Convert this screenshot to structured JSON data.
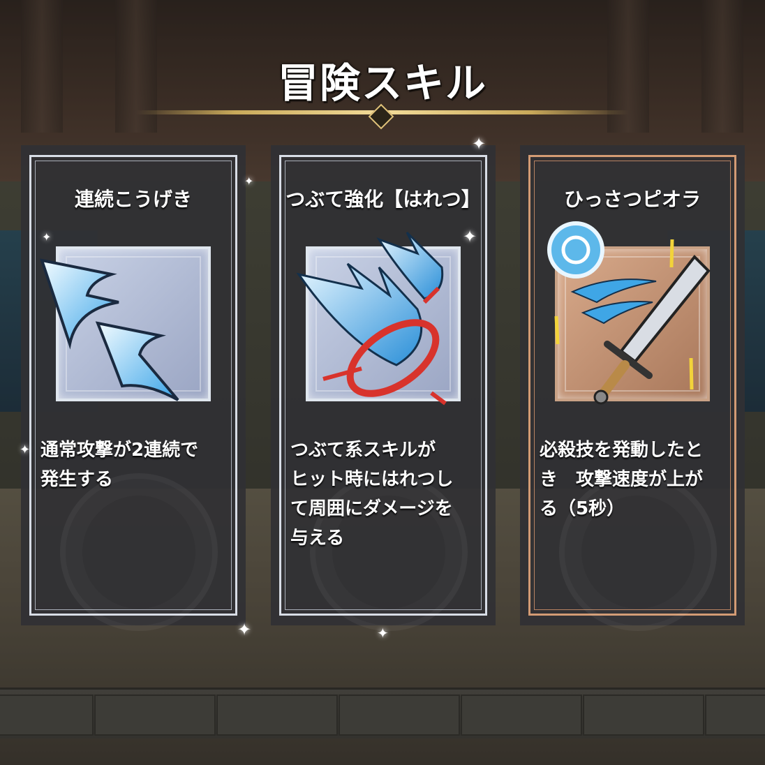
{
  "screen": {
    "title": "冒険スキル"
  },
  "skills": [
    {
      "name": "連続こうげき",
      "icon": "double-arrow-strike-icon",
      "description_lines": [
        "通常攻撃が2連続で",
        "発生する"
      ],
      "selected": false
    },
    {
      "name": "つぶて強化【はれつ】",
      "icon": "ice-burst-ring-icon",
      "description_lines": [
        "つぶて系スキルが",
        "ヒット時にはれつし",
        "て周囲にダメージを",
        "与える"
      ],
      "selected": false
    },
    {
      "name": "ひっさつピオラ",
      "icon": "speed-sword-icon",
      "description_lines": [
        "必殺技を発動したと",
        "き　攻撃速度が上が",
        "る（5秒）"
      ],
      "selected": true
    }
  ],
  "colors": {
    "frame_default": "#d8dde6",
    "frame_selected": "#d39b74",
    "title_line": "#f3dc9a"
  }
}
